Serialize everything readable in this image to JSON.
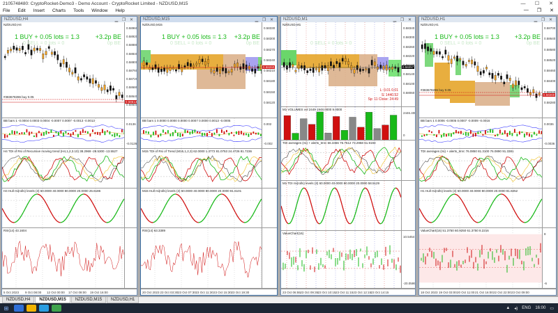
{
  "window": {
    "title": "2105748480: CryptoRocket-Demo3 - Demo Account - CryptoRocket Limited - NZDUSD,M15",
    "minimize": "—",
    "maximize": "☐",
    "close": "✕"
  },
  "menu": [
    "File",
    "Edit",
    "Insert",
    "Charts",
    "Tools",
    "Window",
    "Help"
  ],
  "mdi": {
    "minimize": "—",
    "restore": "❐",
    "close": "✕"
  },
  "charts": [
    {
      "title": "NZDUSD,H4",
      "symbol_label": "NZDUSD,H4",
      "buy_text": "1 BUY + 0.05 lots = 1.3",
      "sell_text": "0 SELL = 0 lots = 0",
      "pl_text": "+3.2p BE",
      "be_text": "0p BE",
      "prices": [
        "0.58960",
        "0.58920",
        "0.58880",
        "0.58840",
        "0.58800",
        "0.58760",
        "0.58720",
        "0.58680",
        "0.58640",
        "0.58600"
      ],
      "price_tag": "0.58613",
      "order_label": "#383678286 buy 0.05",
      "ind1": "BB bars 1 -0.0004 0.0003 0.0004 -0.0007 0.0007 -0.0013 -0.0013",
      "ind1_scale": [
        "0.0136",
        "-0.0126"
      ],
      "ind2": "H4 TDI of Rsi of Recursive moving trend (H4,1,2,3.10) 38.2969 -28.5300 -13.5527",
      "ind3": "H4 Hull rsi(rolls) levels (3) 60.0000 40.0000 80.0000 20.0000 26.6186",
      "ind4": "RSI(14) 43.1604",
      "times": [
        "5 Oct 2023",
        "9 Oct 08:00",
        "12 Oct 00:00",
        "17 Oct 08:00",
        "19 Oct 16:00"
      ]
    },
    {
      "title": "NZDUSD,M15",
      "symbol_label": "NZDUSD,M15",
      "buy_text": "1 BUY + 0.05 lots = 1.3",
      "sell_text": "0 SELL = 0 lots = 0",
      "pl_text": "+3.2p BE",
      "be_text": "0p BE",
      "prices": [
        "0.58330",
        "0.58300",
        "0.58270",
        "0.58240",
        "0.58210",
        "0.58180",
        "0.58150",
        "0.58120"
      ],
      "price_tag": "0.58260",
      "ind1": "BB bars 1 0.0000 0.0000 0.0000 0.0007 0.0000 0.0013 -0.0005",
      "ind1_scale": [
        "0.002",
        "-0.002"
      ],
      "ind2": "M15 TDI of Rsi of Trend (M15,1,2,3) 62.0000 1.3772 81.0753 24.4726 81.7236",
      "ind3": "M15 Hull rsi(rolls) levels (3) 60.0000 40.0000 80.0000 20.0000 81.6101",
      "ind4": "RSI(14) 63.3389",
      "times": [
        "20 Oct 2023",
        "23 Oct 03:30",
        "23 Oct 07:30",
        "23 Oct 11:30",
        "23 Oct 15:30",
        "23 Oct 19:30"
      ]
    },
    {
      "title": "NZDUSD,M1",
      "symbol_label": "NZDUSD,M1",
      "sell_text": "0 SELL = 0 lots = 0",
      "prices": [
        "0.58340",
        "0.58300",
        "0.58260",
        "0.58220",
        "0.58180",
        "0.58140",
        "0.58100",
        "0.58060"
      ],
      "price_tag": "0.58257",
      "red_lines": [
        "L: 0.01 0.01",
        "S: 1440.52",
        "Sp: 11    Close: 24:49"
      ],
      "ind1": "M1 VOLUMES vol 2449 1948.0000 9.0000",
      "ind1_scale": [
        "2446.4000",
        "0"
      ],
      "ind2": "TDI averages (rsi) + alerts_tmrc 66.3466 76.7512 73.2958 61.9193",
      "ind3": "M1 TDI rsi(rolls) levels (3) 60.0000 40.0000 80.0000 20.0000 58.5129",
      "ind4": "ValueChart(16)",
      "ind4_scale": [
        "10.5454",
        "-20.0599"
      ],
      "times": [
        "23 Oct 06:55",
        "23 Oct 09:35",
        "23 Oct 10:15",
        "23 Oct 11:15",
        "23 Oct 12:15",
        "23 Oct 14:15"
      ]
    },
    {
      "title": "NZDUSD,H1",
      "symbol_label": "NZDUSD,H1",
      "buy_text": "1 BUY + 0.05 lots = 1.3",
      "sell_text": "0 SELL = 0 lots = 0",
      "pl_text": "+3.2p BE",
      "be_text": "0p BE",
      "prices": [
        "0.58700",
        "0.58640",
        "0.58580",
        "0.58520",
        "0.58460",
        "0.58400",
        "0.58340",
        "0.58280"
      ],
      "price_tag": "0.58260",
      "order_label": "#383678286 buy 0.05",
      "ind1": "BB bars 1 0.0006 -0.0005 0.0007 -0.0009 -0.0016",
      "ind1_scale": [
        "0.0036",
        "-0.0036"
      ],
      "ind2": "TDI averages (rsi) + alerts_tmrc 76.0850 81.3100 76.0890 91.3381",
      "ind3": "H1 Hull rsi(rolls) levels (3) 60.0000 40.0000 80.0000 20.0000 81.8252",
      "ind4": "ValueChart(16) 51.3750 60.9250 61.3750 8.2216",
      "ind4_scale": [
        "8",
        "-6"
      ],
      "times": [
        "18 Oct 2023",
        "19 Oct 03:00",
        "20 Oct 11:00",
        "21 Oct 16:00",
        "22 Oct 22:00",
        "23 Oct 09:00"
      ]
    }
  ],
  "tabs": [
    "NZDUSD,H4",
    "NZDUSD,M15",
    "NZDUSD,M15",
    "NZDUSD,H1"
  ],
  "active_tab": 1,
  "tray": {
    "lang": "ENG",
    "time": "16:00",
    "date": "23/10/2023"
  },
  "colors": {
    "bull": "#19b919",
    "bear": "#d01010",
    "accent": "#3a6ea5",
    "orange": "#e09b1a",
    "tan": "#d2a070",
    "bband": "#4040ff"
  }
}
